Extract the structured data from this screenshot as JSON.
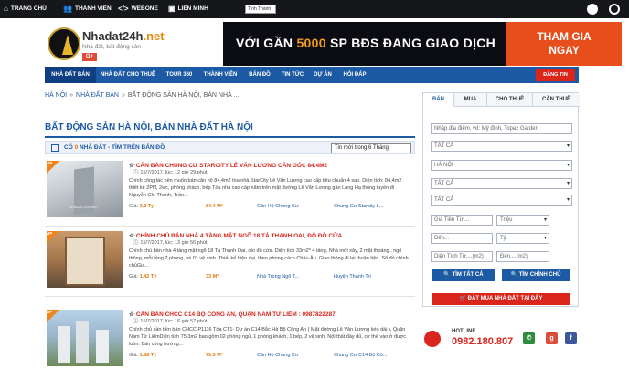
{
  "topbar": {
    "home": "TRANG CHỦ",
    "member": "THÀNH VIÊN",
    "webone": "WEBONE",
    "partner": "LIÊN MINH",
    "province_select": "Tỉnh Thành"
  },
  "header": {
    "brand_name": "Nhadat24h",
    "brand_tld": ".net",
    "tagline": "Nhà đất, bất động sản",
    "gplus": "G+",
    "banner_text": "VỚI GẦN ",
    "banner_highlight": "5000",
    "banner_text2": " SP BĐS ĐANG GIAO DỊCH",
    "banner_cta_line1": "THAM GIA",
    "banner_cta_line2": "NGAY"
  },
  "nav": {
    "items": [
      "NHÀ ĐẤT BÁN",
      "NHÀ ĐẤT CHO THUÊ",
      "TOUR 360",
      "THÀNH VIÊN",
      "BÁN ĐỒ",
      "TIN TỨC",
      "DỰ ÁN",
      "HỎI ĐÁP"
    ],
    "post_button": "ĐĂNG TIN"
  },
  "breadcrumb": {
    "items": [
      "HÀ NỘI",
      "NHÀ ĐẤT BÁN",
      "BẤT ĐỘNG SẢN HÀ NỘI, BÁN NHÀ ..."
    ],
    "sep": "»"
  },
  "page": {
    "title": "BẤT ĐỘNG SẢN HÀ NỘI, BÁN NHÀ ĐẤT HÀ NỘI",
    "filter_prefix": "CÓ ",
    "filter_count": "0",
    "filter_suffix": " NHÀ ĐẤT",
    "filter_map": " - TÌM TRÊN BẢN ĐỒ",
    "sort_select": "Tin mới trong 6 Tháng"
  },
  "listings": [
    {
      "badge": "VIP",
      "title": "CĂN BÁN CHUNG CƯ STARCITY LÊ VĂN LƯƠNG CĂN GÓC 84.4M2",
      "date": "15/7/2017, lúc: 12 giờ 29 phút",
      "desc": "Chính công tác nên muốn bán căn hộ 84,4m2 tòa nhà StarCity Lê Văn Lương cao cấp tiêu chuẩn 4 sao. Diện tích: 84,4m2 thiết kế 2PN, 2wc, phòng khách, bếp Tòa nhà cao cấp nằm trên mặt đường Lê Văn Lương gần Láng Hạ thông tuyến đi Nguyễn Chí Thanh, Trần...",
      "price_label": "Giá:",
      "price": "3.3 Tỷ",
      "area": "84.4 M²",
      "type": "Căn Hộ Chung Cư",
      "location": "Chung Cư Starcity L..."
    },
    {
      "badge": "VIP",
      "title": "CHÍNH CHỦ BÁN NHÀ 4 TẦNG MẶT NGÕ 18 TÁ THANH OAI, ĐỖ ĐỒ CỬA",
      "date": "15/7/2017, lúc: 13 giờ 56 phút",
      "desc": "Chính chủ bán nhà 4 tầng mặt ngõ 18 Tả Thanh Oai, oto đỗ cửa. Diện tích 33m2* 4 tầng, Nhà mới xây, 2 mặt thoáng , ngõ thông, mỗi tầng 2 phòng, và 01 vệ sinh. Thiết kế hiện đại, theo phong cách Châu Âu. Giao thông đi lại thuận tiện. Sổ đỏ chính chủGia...",
      "price_label": "Giá:",
      "price": "1.42 Tỷ",
      "area": "33 M²",
      "type": "Nhà Trong Ngõ T...",
      "location": "Huyện Thanh Trì"
    },
    {
      "badge": "VIP",
      "title": "CẦN BÁN CHCC C14 BỘ CÔNG AN, QUẬN NAM TỪ LIÊM : 0987822287",
      "date": "15/7/2017, lúc: 16 giờ 57 phút",
      "desc": "Chính chủ cần tiền bán CHCC P1116 Tòa CT1- Dự án C14 Bắc Hà Bộ Công An ( Mặt đường Lê Văn Lương kéo dài ), Quận Nam Từ LiêmDiện tích 75,3m2 bao gồm 02 phòng ngủ, 1 phòng khách, 1 bếp, 2 vệ sinh. Nội thất đầy đủ, cơ thể vào ở được luôn. Bán công hướng...",
      "price_label": "Giá:",
      "price": "1.88 Tỷ",
      "area": "75.3 M²",
      "type": "Căn Hộ Chung Cư",
      "location": "Chung Cư C14 Bộ Cô..."
    }
  ],
  "thumb_watermark": "NHADAT24H.NET",
  "search": {
    "tabs": [
      "BÁN",
      "MUA",
      "CHO THUÊ",
      "CẦN THUÊ"
    ],
    "keyword_placeholder": "Nhập địa điểm, vd: Mỹ đình, Topaz Garden",
    "select1": "TẤT CẢ",
    "city": "HÀ NỘI",
    "select3": "TẤT CẢ",
    "select4": "TẤT CẢ",
    "price_from": "Giá Tiền Từ....",
    "price_unit": "Triệu",
    "to1": "Đến...",
    "unit2": "Tỷ",
    "area_from": "Diện Tích Từ....(m2)",
    "area_to": "Đến....(m2)",
    "search_all": "TÌM TẤT CẢ",
    "search_owner": "TÌM CHÍNH CHỦ",
    "buy_request": "ĐĂT MUA NHÀ ĐẤT TẠI ĐÂY"
  },
  "hotline": {
    "label": "HOTLINE",
    "number": "0982.180.807"
  },
  "social": [
    "phone-green",
    "g+",
    "gplus-circle",
    "f"
  ],
  "colors": {
    "primary": "#1d5aa5",
    "accent": "#d9251c",
    "orange": "#e86b14",
    "topbar": "#16171b"
  }
}
